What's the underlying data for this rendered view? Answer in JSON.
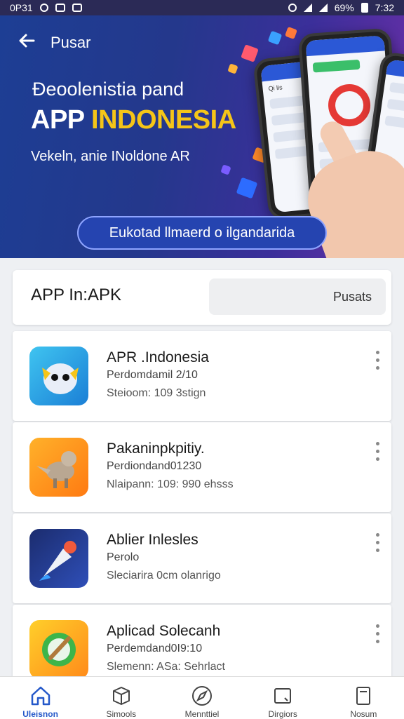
{
  "status_bar": {
    "time_left": "0P31",
    "battery": "69%",
    "time_right": "7:32"
  },
  "header": {
    "title": "Pusar"
  },
  "banner": {
    "headline_line1": "Đeoolenistia pand",
    "headline_app": "APP ",
    "headline_brand": "INDONESIA",
    "tagline": "Vekeln, anie INoldone AR",
    "cta_label": "Eukotad llmaerd o ilgandarida",
    "phone_label": "Qi lis"
  },
  "search": {
    "title": "APP In:APK",
    "button_label": "Pusats"
  },
  "apps": [
    {
      "name": "APR .Indonesia",
      "line1": "Perdomdamil 2/10",
      "line2": "Steioom: 109 3stign"
    },
    {
      "name": "Pakaninpkpitiy.",
      "line1": "Perdiondand01230",
      "line2": "Nlaipann: 109: 990 ehsss"
    },
    {
      "name": "Ablier Inlesles",
      "line1": "Perolo",
      "line2": "Sleciarira 0cm olanrigo"
    },
    {
      "name": "Aplicad Solecanh",
      "line1": "Perdemdand0I9:10",
      "line2": "Slemenn: ASa: Sehrlact"
    }
  ],
  "bottom_nav": [
    {
      "label": "Uleisnon",
      "icon": "home-icon"
    },
    {
      "label": "Simools",
      "icon": "box-icon"
    },
    {
      "label": "Mennttiel",
      "icon": "compass-icon"
    },
    {
      "label": "Dirgiors",
      "icon": "folder-icon"
    },
    {
      "label": "Nosum",
      "icon": "document-icon"
    }
  ],
  "colors": {
    "accent": "#2458c9",
    "brand_yellow": "#f5c518",
    "banner_start": "#1d3e94",
    "banner_end": "#6a2fa8"
  }
}
